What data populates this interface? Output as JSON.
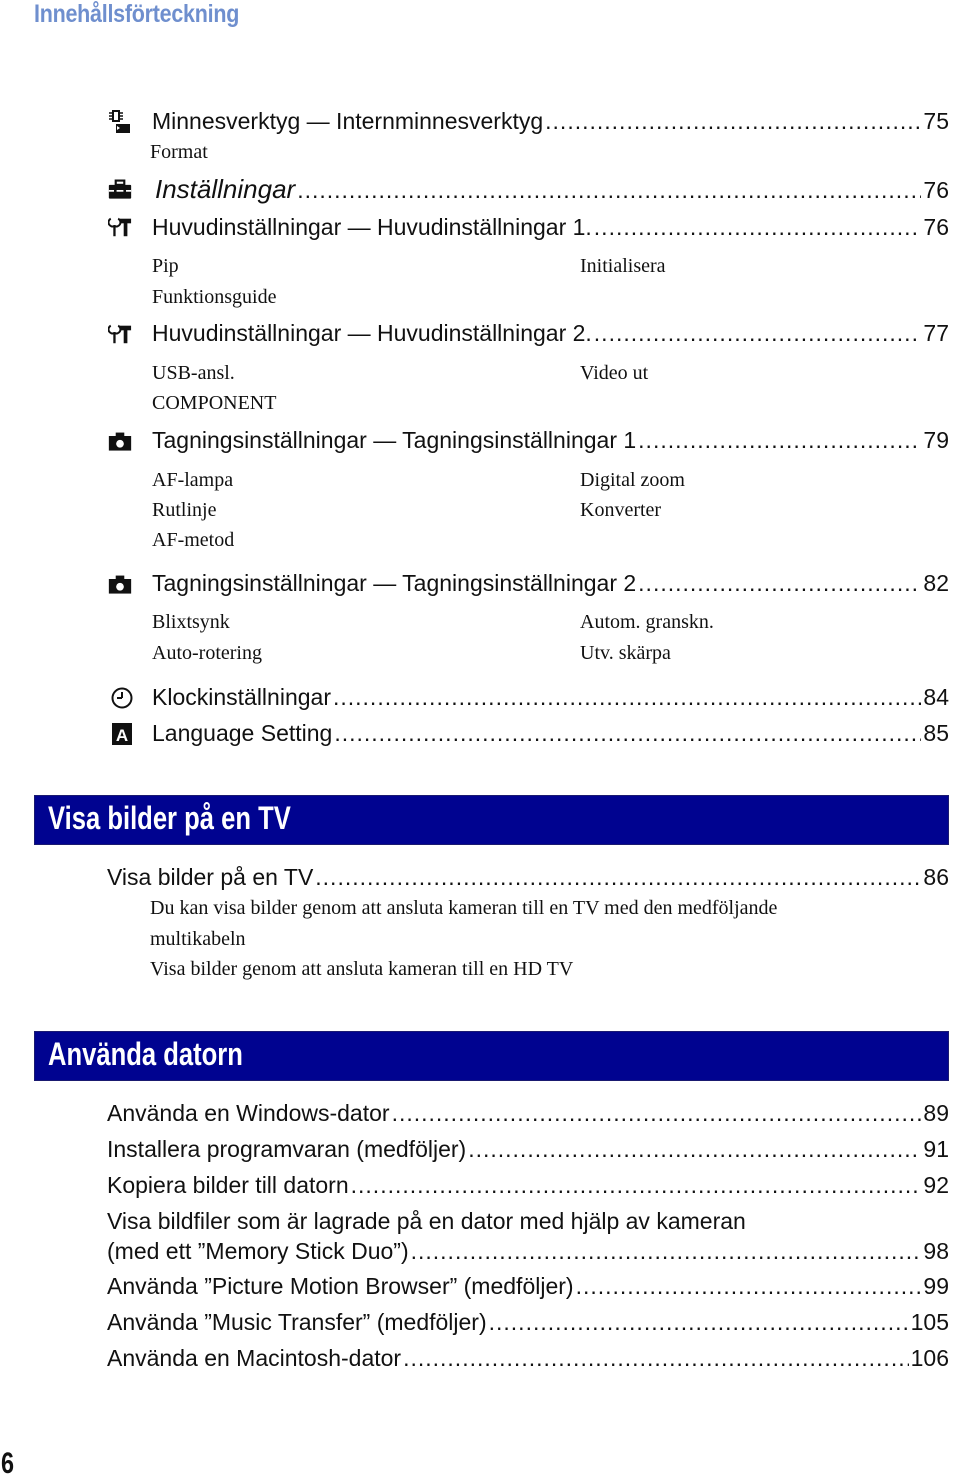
{
  "page_heading": "Innehållsförteckning",
  "colors": {
    "heading": "#6f8fce",
    "banner": "#000390",
    "banner_text": "#ffffff"
  },
  "settings_section": {
    "entries": [
      {
        "icon": "memory-tool-icon",
        "label": "Minnesverktyg — Internminnesverktyg",
        "page": "75",
        "subs_left": [
          "Format"
        ],
        "subs_right": []
      },
      {
        "icon": "toolbox-icon",
        "label": "Inställningar",
        "page": "76",
        "italic": true,
        "subs_left": [],
        "subs_right": []
      },
      {
        "icon": "main-settings-icon",
        "label": "Huvudinställningar — Huvudinställningar 1.",
        "page": "76",
        "subs_left": [
          "Pip",
          "Funktionsguide"
        ],
        "subs_right": [
          "Initialisera"
        ]
      },
      {
        "icon": "main-settings-icon",
        "label": "Huvudinställningar — Huvudinställningar 2.",
        "page": "77",
        "subs_left": [
          "USB-ansl.",
          "COMPONENT"
        ],
        "subs_right": [
          "Video ut"
        ]
      },
      {
        "icon": "camera-icon",
        "label": "Tagningsinställningar — Tagningsinställningar 1",
        "page": "79",
        "subs_left": [
          "AF-lampa",
          "Rutlinje",
          "AF-metod"
        ],
        "subs_right": [
          "Digital zoom",
          "Konverter"
        ]
      },
      {
        "icon": "camera-icon",
        "label": "Tagningsinställningar — Tagningsinställningar 2",
        "page": "82",
        "subs_left": [
          "Blixtsynk",
          "Auto-rotering"
        ],
        "subs_right": [
          "Autom. granskn.",
          "Utv. skärpa"
        ]
      },
      {
        "icon": "clock-icon",
        "label": "Klockinställningar",
        "page": "84",
        "subs_left": [],
        "subs_right": []
      },
      {
        "icon": "language-icon",
        "label": "Language Setting ",
        "page": "85",
        "subs_left": [],
        "subs_right": []
      }
    ]
  },
  "tv_section": {
    "title": "Visa bilder på en TV",
    "entries": [
      {
        "label": "Visa bilder på en TV",
        "page": "86",
        "subs": [
          "Du kan visa bilder genom att ansluta kameran till en TV med den medföljande",
          "multikabeln",
          "Visa bilder genom att ansluta kameran till en HD TV"
        ]
      }
    ]
  },
  "computer_section": {
    "title": "Använda datorn",
    "entries": [
      {
        "label": "Använda en Windows-dator",
        "page": "89"
      },
      {
        "label": "Installera programvaran (medföljer) ",
        "page": "91"
      },
      {
        "label": "Kopiera bilder till datorn ",
        "page": "92"
      },
      {
        "label_line1": "Visa bildfiler som är lagrade på en dator med hjälp av kameran",
        "label": "(med ett ”Memory Stick Duo”)",
        "page": "98"
      },
      {
        "label": "Använda ”Picture Motion Browser” (medföljer) ",
        "page": "99"
      },
      {
        "label": "Använda ”Music Transfer” (medföljer)",
        "page": "105"
      },
      {
        "label": "Använda en Macintosh-dator ",
        "page": "106"
      }
    ]
  },
  "footer": {
    "page_number": "6"
  }
}
